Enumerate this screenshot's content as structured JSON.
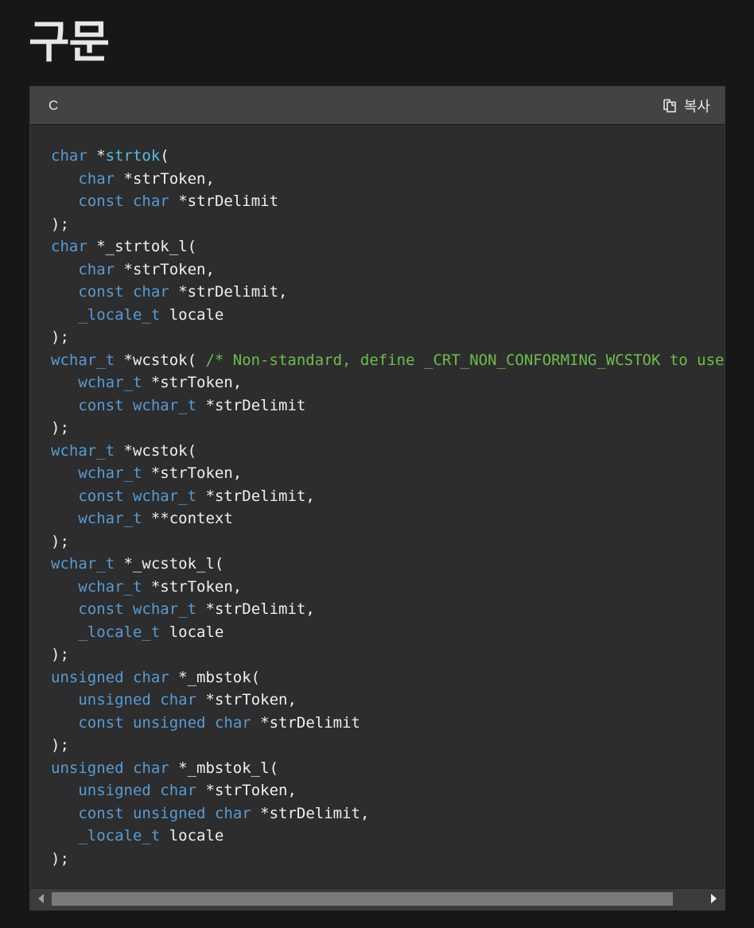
{
  "page": {
    "heading": "구문"
  },
  "code_block": {
    "language": "C",
    "copy_label": "복사",
    "colors": {
      "keyword": "#569cd6",
      "function": "#4fc1e9",
      "comment": "#6abf4b",
      "text": "#f0f0f0"
    },
    "lines": [
      [
        {
          "t": "kw",
          "v": "char"
        },
        {
          "t": "tx",
          "v": " *"
        },
        {
          "t": "fn",
          "v": "strtok"
        },
        {
          "t": "tx",
          "v": "("
        }
      ],
      [
        {
          "t": "tx",
          "v": "   "
        },
        {
          "t": "kw",
          "v": "char"
        },
        {
          "t": "tx",
          "v": " *strToken,"
        }
      ],
      [
        {
          "t": "tx",
          "v": "   "
        },
        {
          "t": "kw",
          "v": "const"
        },
        {
          "t": "tx",
          "v": " "
        },
        {
          "t": "kw",
          "v": "char"
        },
        {
          "t": "tx",
          "v": " *strDelimit"
        }
      ],
      [
        {
          "t": "tx",
          "v": ");"
        }
      ],
      [
        {
          "t": "kw",
          "v": "char"
        },
        {
          "t": "tx",
          "v": " *_strtok_l("
        }
      ],
      [
        {
          "t": "tx",
          "v": "   "
        },
        {
          "t": "kw",
          "v": "char"
        },
        {
          "t": "tx",
          "v": " *strToken,"
        }
      ],
      [
        {
          "t": "tx",
          "v": "   "
        },
        {
          "t": "kw",
          "v": "const"
        },
        {
          "t": "tx",
          "v": " "
        },
        {
          "t": "kw",
          "v": "char"
        },
        {
          "t": "tx",
          "v": " *strDelimit,"
        }
      ],
      [
        {
          "t": "tx",
          "v": "   "
        },
        {
          "t": "kw",
          "v": "_locale_t"
        },
        {
          "t": "tx",
          "v": " locale"
        }
      ],
      [
        {
          "t": "tx",
          "v": ");"
        }
      ],
      [
        {
          "t": "kw",
          "v": "wchar_t"
        },
        {
          "t": "tx",
          "v": " *wcstok( "
        },
        {
          "t": "cm",
          "v": "/* Non-standard, define _CRT_NON_CONFORMING_WCSTOK to use"
        }
      ],
      [
        {
          "t": "tx",
          "v": "   "
        },
        {
          "t": "kw",
          "v": "wchar_t"
        },
        {
          "t": "tx",
          "v": " *strToken,"
        }
      ],
      [
        {
          "t": "tx",
          "v": "   "
        },
        {
          "t": "kw",
          "v": "const"
        },
        {
          "t": "tx",
          "v": " "
        },
        {
          "t": "kw",
          "v": "wchar_t"
        },
        {
          "t": "tx",
          "v": " *strDelimit"
        }
      ],
      [
        {
          "t": "tx",
          "v": ");"
        }
      ],
      [
        {
          "t": "kw",
          "v": "wchar_t"
        },
        {
          "t": "tx",
          "v": " *wcstok("
        }
      ],
      [
        {
          "t": "tx",
          "v": "   "
        },
        {
          "t": "kw",
          "v": "wchar_t"
        },
        {
          "t": "tx",
          "v": " *strToken,"
        }
      ],
      [
        {
          "t": "tx",
          "v": "   "
        },
        {
          "t": "kw",
          "v": "const"
        },
        {
          "t": "tx",
          "v": " "
        },
        {
          "t": "kw",
          "v": "wchar_t"
        },
        {
          "t": "tx",
          "v": " *strDelimit,"
        }
      ],
      [
        {
          "t": "tx",
          "v": "   "
        },
        {
          "t": "kw",
          "v": "wchar_t"
        },
        {
          "t": "tx",
          "v": " **context"
        }
      ],
      [
        {
          "t": "tx",
          "v": ");"
        }
      ],
      [
        {
          "t": "kw",
          "v": "wchar_t"
        },
        {
          "t": "tx",
          "v": " *_wcstok_l("
        }
      ],
      [
        {
          "t": "tx",
          "v": "   "
        },
        {
          "t": "kw",
          "v": "wchar_t"
        },
        {
          "t": "tx",
          "v": " *strToken,"
        }
      ],
      [
        {
          "t": "tx",
          "v": "   "
        },
        {
          "t": "kw",
          "v": "const"
        },
        {
          "t": "tx",
          "v": " "
        },
        {
          "t": "kw",
          "v": "wchar_t"
        },
        {
          "t": "tx",
          "v": " *strDelimit,"
        }
      ],
      [
        {
          "t": "tx",
          "v": "   "
        },
        {
          "t": "kw",
          "v": "_locale_t"
        },
        {
          "t": "tx",
          "v": " locale"
        }
      ],
      [
        {
          "t": "tx",
          "v": ");"
        }
      ],
      [
        {
          "t": "kw",
          "v": "unsigned"
        },
        {
          "t": "tx",
          "v": " "
        },
        {
          "t": "kw",
          "v": "char"
        },
        {
          "t": "tx",
          "v": " *_mbstok("
        }
      ],
      [
        {
          "t": "tx",
          "v": "   "
        },
        {
          "t": "kw",
          "v": "unsigned"
        },
        {
          "t": "tx",
          "v": " "
        },
        {
          "t": "kw",
          "v": "char"
        },
        {
          "t": "tx",
          "v": " *strToken,"
        }
      ],
      [
        {
          "t": "tx",
          "v": "   "
        },
        {
          "t": "kw",
          "v": "const"
        },
        {
          "t": "tx",
          "v": " "
        },
        {
          "t": "kw",
          "v": "unsigned"
        },
        {
          "t": "tx",
          "v": " "
        },
        {
          "t": "kw",
          "v": "char"
        },
        {
          "t": "tx",
          "v": " *strDelimit"
        }
      ],
      [
        {
          "t": "tx",
          "v": ");"
        }
      ],
      [
        {
          "t": "kw",
          "v": "unsigned"
        },
        {
          "t": "tx",
          "v": " "
        },
        {
          "t": "kw",
          "v": "char"
        },
        {
          "t": "tx",
          "v": " *_mbstok_l("
        }
      ],
      [
        {
          "t": "tx",
          "v": "   "
        },
        {
          "t": "kw",
          "v": "unsigned"
        },
        {
          "t": "tx",
          "v": " "
        },
        {
          "t": "kw",
          "v": "char"
        },
        {
          "t": "tx",
          "v": " *strToken,"
        }
      ],
      [
        {
          "t": "tx",
          "v": "   "
        },
        {
          "t": "kw",
          "v": "const"
        },
        {
          "t": "tx",
          "v": " "
        },
        {
          "t": "kw",
          "v": "unsigned"
        },
        {
          "t": "tx",
          "v": " "
        },
        {
          "t": "kw",
          "v": "char"
        },
        {
          "t": "tx",
          "v": " *strDelimit,"
        }
      ],
      [
        {
          "t": "tx",
          "v": "   "
        },
        {
          "t": "kw",
          "v": "_locale_t"
        },
        {
          "t": "tx",
          "v": " locale"
        }
      ],
      [
        {
          "t": "tx",
          "v": ");"
        }
      ]
    ]
  },
  "scrollbar": {
    "left_icon": "scroll-left-arrow-icon",
    "right_icon": "scroll-right-arrow-icon"
  }
}
